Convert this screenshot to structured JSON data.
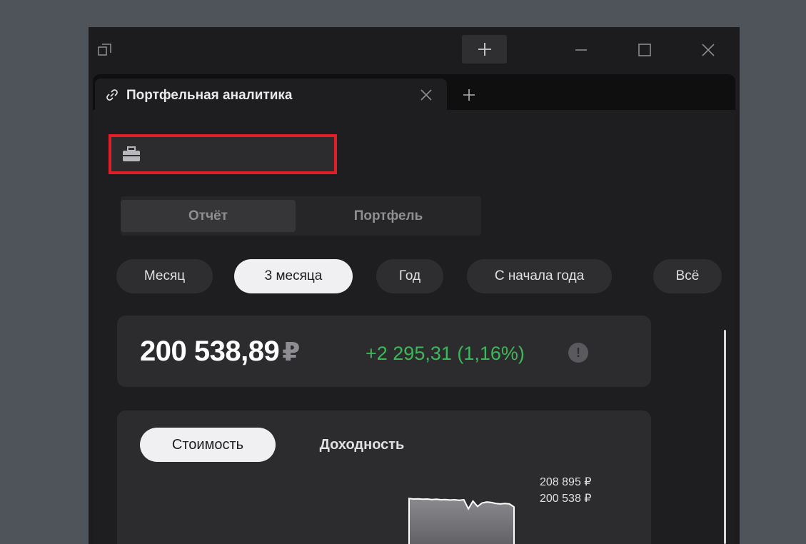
{
  "window": {
    "add_window_label": "+"
  },
  "tab": {
    "title": "Портфельная аналитика",
    "close_label": "✕",
    "new_tab_label": "+"
  },
  "portfolio_select": {
    "value": ""
  },
  "segments": [
    {
      "label": "Отчёт",
      "active": true
    },
    {
      "label": "Портфель",
      "active": false
    }
  ],
  "periods": [
    {
      "label": "Месяц",
      "active": false
    },
    {
      "label": "3 месяца",
      "active": true
    },
    {
      "label": "Год",
      "active": false
    },
    {
      "label": "С начала года",
      "active": false
    },
    {
      "label": "Всё",
      "active": false
    }
  ],
  "summary": {
    "total": "200 538,89",
    "currency": "₽",
    "change": "+2 295,31 (1,16%)",
    "info_label": "!"
  },
  "chart": {
    "tabs": [
      {
        "label": "Стоимость",
        "active": true
      },
      {
        "label": "Доходность",
        "active": false
      }
    ],
    "max_label": "208 895 ₽",
    "current_label": "200 538 ₽"
  },
  "chart_data": {
    "type": "area",
    "y": [
      206100,
      206000,
      206050,
      205950,
      206000,
      205900,
      205950,
      205850,
      205900,
      205800,
      205850,
      205750,
      205850,
      204000,
      205600,
      204500,
      205200,
      205400,
      205300,
      205100,
      205000,
      205100,
      205000,
      204400
    ],
    "series": [
      {
        "name": "",
        "values": []
      }
    ]
  },
  "colors": {
    "accent_positive": "#3fb65a",
    "highlight_border": "#e21e26"
  }
}
